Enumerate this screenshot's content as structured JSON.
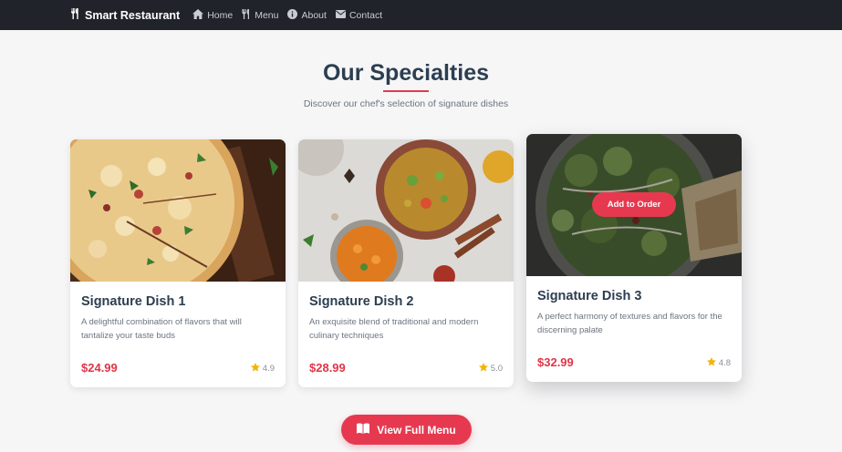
{
  "navbar": {
    "brand": "Smart Restaurant",
    "brand_icon": "utensils-icon",
    "links": [
      {
        "label": "Home",
        "icon": "home-icon"
      },
      {
        "label": "Menu",
        "icon": "utensils-icon"
      },
      {
        "label": "About",
        "icon": "info-icon"
      },
      {
        "label": "Contact",
        "icon": "envelope-icon"
      }
    ]
  },
  "header": {
    "title": "Our Specialties",
    "subtitle": "Discover our chef's selection of signature dishes"
  },
  "cards": [
    {
      "title": "Signature Dish 1",
      "description": "A delightful combination of flavors that will tantalize your taste buds",
      "price": "$24.99",
      "rating": "4.9",
      "image": "pizza-image"
    },
    {
      "title": "Signature Dish 2",
      "description": "An exquisite blend of traditional and modern culinary techniques",
      "price": "$28.99",
      "rating": "5.0",
      "image": "curry-image"
    },
    {
      "title": "Signature Dish 3",
      "description": "A perfect harmony of textures and flavors for the discerning palate",
      "price": "$32.99",
      "rating": "4.8",
      "image": "salad-image",
      "hover_button": "Add to Order"
    }
  ],
  "cta": {
    "label": "View Full Menu",
    "icon": "book-icon"
  },
  "colors": {
    "accent": "#e63950",
    "navbar": "#202329",
    "price": "#e03548",
    "star": "#f4b400",
    "title": "#2c3e50"
  }
}
